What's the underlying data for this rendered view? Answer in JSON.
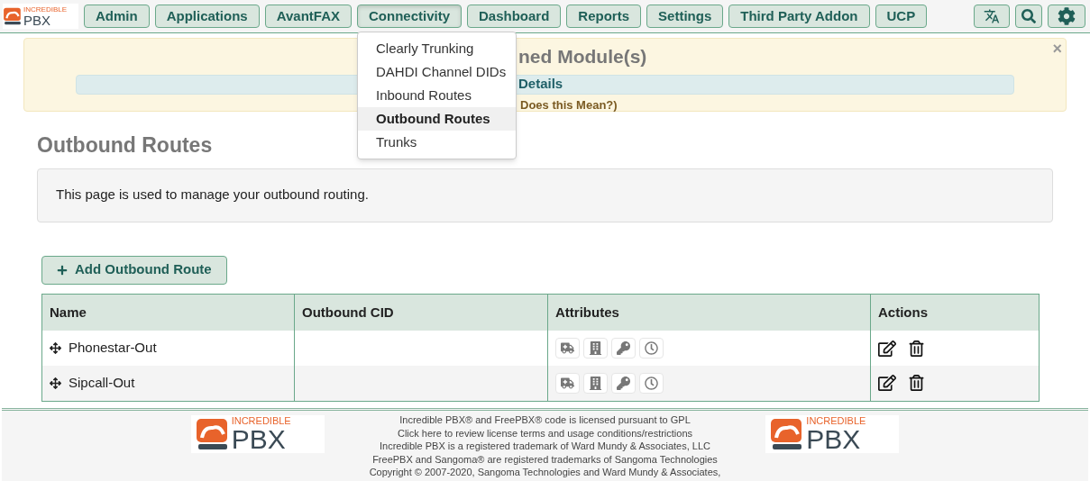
{
  "logo": {
    "top": "INCREDIBLE",
    "main": "PBX"
  },
  "nav": [
    {
      "label": "Admin",
      "open": false
    },
    {
      "label": "Applications",
      "open": false
    },
    {
      "label": "AvantFAX",
      "open": false
    },
    {
      "label": "Connectivity",
      "open": true
    },
    {
      "label": "Dashboard",
      "open": false
    },
    {
      "label": "Reports",
      "open": false
    },
    {
      "label": "Settings",
      "open": false
    },
    {
      "label": "Third Party Addon",
      "open": false
    },
    {
      "label": "UCP",
      "open": false
    }
  ],
  "menu": [
    {
      "label": "Clearly Trunking",
      "selected": false
    },
    {
      "label": "DAHDI Channel DIDs",
      "selected": false
    },
    {
      "label": "Inbound Routes",
      "selected": false
    },
    {
      "label": "Outbound Routes",
      "selected": true
    },
    {
      "label": "Trunks",
      "selected": false
    }
  ],
  "banner": {
    "title": "ned Module(s)",
    "details": "Details",
    "help": "Does this Mean?)",
    "close": "×"
  },
  "page_title": "Outbound Routes",
  "description": "This page is used to manage your outbound routing.",
  "add_button": "Add Outbound Route",
  "table": {
    "columns": [
      "Name",
      "Outbound CID",
      "Attributes",
      "Actions"
    ],
    "rows": [
      {
        "name": "Phonestar-Out",
        "cid": ""
      },
      {
        "name": "Sipcall-Out",
        "cid": ""
      }
    ]
  },
  "footer": {
    "lines": [
      "Incredible PBX® and FreePBX® code is licensed pursuant to GPL",
      "Click here to review license terms and usage conditions/restrictions",
      "Incredible PBX is a registered trademark of Ward Mundy & Associates, LLC",
      "FreePBX and Sangoma® are registered trademarks of Sangoma Technologies",
      "Copyright © 2007-2020, Sangoma Technologies and Ward Mundy & Associates,"
    ],
    "logos": [
      {
        "top": "INCREDIBLE",
        "main": "PBX"
      },
      {
        "top": "INCREDIBLE",
        "main": "PBX"
      }
    ]
  }
}
